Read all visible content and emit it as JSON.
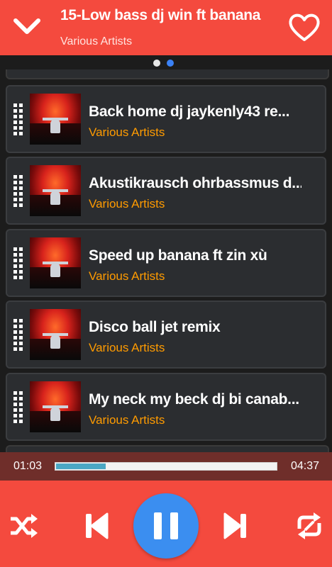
{
  "header": {
    "title": "15-Low bass dj win ft banana",
    "subtitle": "Various Artists"
  },
  "pager": {
    "active_index": 1,
    "count": 2
  },
  "songs": [
    {
      "title": "Back home dj jaykenly43 re...",
      "artist": "Various Artists"
    },
    {
      "title": "Akustikrausch ohrbassmus d...",
      "artist": "Various Artists"
    },
    {
      "title": "Speed up banana ft zin xù",
      "artist": "Various Artists"
    },
    {
      "title": "Disco ball jet remix",
      "artist": "Various Artists"
    },
    {
      "title": "My neck my beck dj bi canab...",
      "artist": "Various Artists"
    }
  ],
  "player": {
    "current_time": "01:03",
    "total_time": "04:37",
    "progress": 0.227
  },
  "controls": {
    "icons": [
      "shuffle-icon",
      "previous-icon",
      "pause-icon",
      "next-icon",
      "repeat-icon"
    ]
  },
  "colors": {
    "accent": "#f44a3e",
    "play_button": "#3b8ef0",
    "artist_text": "#ff9b00",
    "progress_fill": "#4aa7c4"
  }
}
